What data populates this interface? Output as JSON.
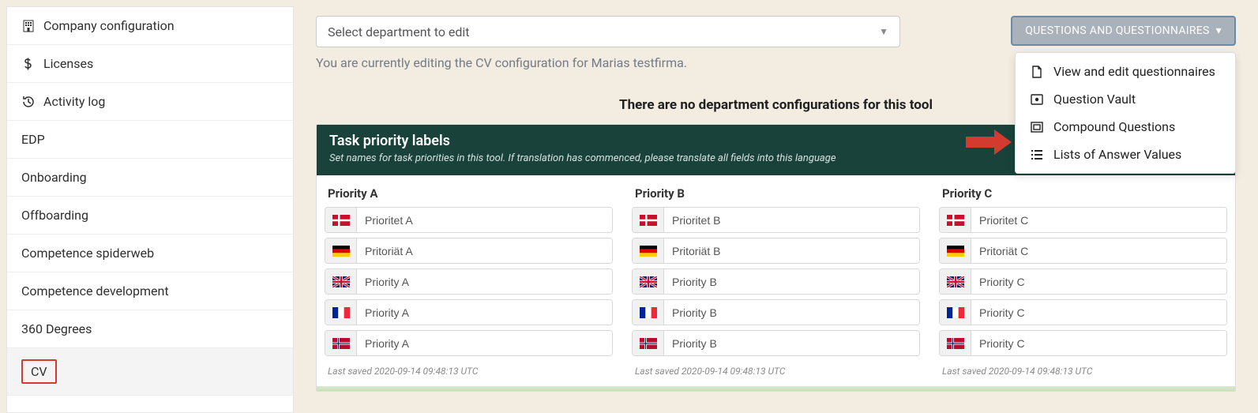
{
  "sidebar": {
    "items": [
      {
        "label": "Company configuration",
        "icon": "building"
      },
      {
        "label": "Licenses",
        "icon": "dollar"
      },
      {
        "label": "Activity log",
        "icon": "history"
      },
      {
        "label": "EDP",
        "icon": ""
      },
      {
        "label": "Onboarding",
        "icon": ""
      },
      {
        "label": "Offboarding",
        "icon": ""
      },
      {
        "label": "Competence spiderweb",
        "icon": ""
      },
      {
        "label": "Competence development",
        "icon": ""
      },
      {
        "label": "360 Degrees",
        "icon": ""
      },
      {
        "label": "CV",
        "icon": "",
        "active": true
      }
    ]
  },
  "topbar": {
    "select_placeholder": "Select department to edit",
    "editing_note": "You are currently editing the CV configuration for Marias testfirma.",
    "no_dept": "There are no department configurations for this tool"
  },
  "dropdown": {
    "button": "QUESTIONS AND QUESTIONNAIRES",
    "items": [
      {
        "label": "View and edit questionnaires",
        "icon": "file"
      },
      {
        "label": "Question Vault",
        "icon": "vault"
      },
      {
        "label": "Compound Questions",
        "icon": "group"
      },
      {
        "label": "Lists of Answer Values",
        "icon": "list"
      }
    ]
  },
  "panel": {
    "title": "Task priority labels",
    "subtitle": "Set names for task priorities in this tool. If translation has commenced, please translate all fields into this language",
    "columns": [
      {
        "title": "Priority A",
        "rows": [
          {
            "flag": "dk",
            "value": "Prioritet A"
          },
          {
            "flag": "de",
            "value": "Pritoriät A"
          },
          {
            "flag": "uk",
            "value": "Priority A"
          },
          {
            "flag": "fr",
            "value": "Priority A"
          },
          {
            "flag": "no",
            "value": "Priority A"
          }
        ],
        "saved": "Last saved 2020-09-14 09:48:13 UTC"
      },
      {
        "title": "Priority B",
        "rows": [
          {
            "flag": "dk",
            "value": "Prioritet B"
          },
          {
            "flag": "de",
            "value": "Pritoriät B"
          },
          {
            "flag": "uk",
            "value": "Priority B"
          },
          {
            "flag": "fr",
            "value": "Priority B"
          },
          {
            "flag": "no",
            "value": "Priority B"
          }
        ],
        "saved": "Last saved 2020-09-14 09:48:13 UTC"
      },
      {
        "title": "Priority C",
        "rows": [
          {
            "flag": "dk",
            "value": "Prioritet C"
          },
          {
            "flag": "de",
            "value": "Pritoriät C"
          },
          {
            "flag": "uk",
            "value": "Priority C"
          },
          {
            "flag": "fr",
            "value": "Priority C"
          },
          {
            "flag": "no",
            "value": "Priority C"
          }
        ],
        "saved": "Last saved 2020-09-14 09:48:13 UTC"
      }
    ]
  }
}
